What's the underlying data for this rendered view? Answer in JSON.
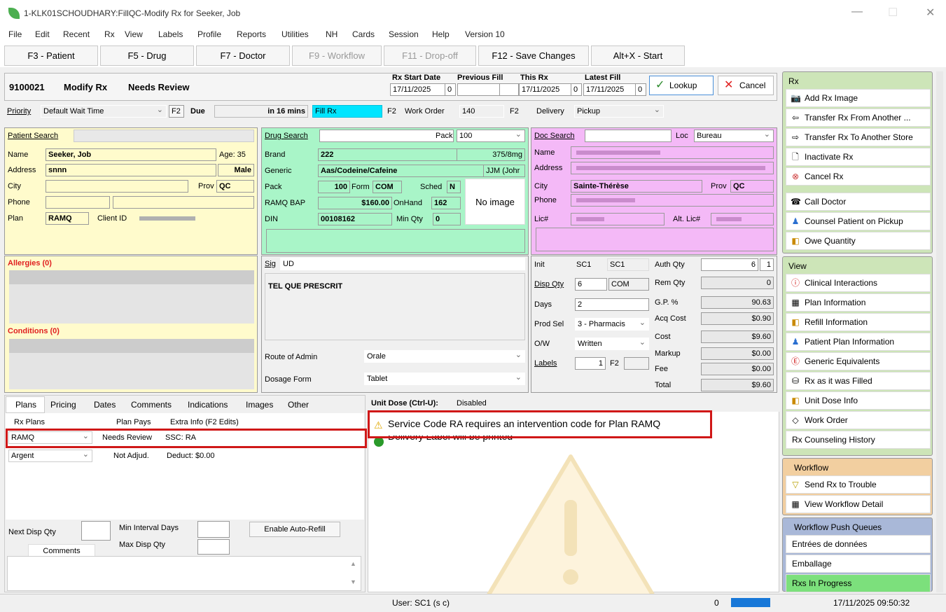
{
  "window": {
    "title": "1-KLK01SCHOUDHARY:FillQC-Modify Rx for Seeker, Job"
  },
  "menu": [
    "File",
    "Edit",
    "Recent",
    "Rx",
    "View",
    "Labels",
    "Profile",
    "Reports",
    "Utilities",
    "NH",
    "Cards",
    "Session",
    "Help",
    "Version 10"
  ],
  "fkeys": [
    "F3 - Patient",
    "F5 - Drug",
    "F7 - Doctor",
    "F9 - Workflow",
    "F11 - Drop-off",
    "F12 - Save Changes",
    "Alt+X - Start"
  ],
  "header": {
    "rx_number": "9100021",
    "mode": "Modify Rx",
    "status": "Needs Review",
    "start_date_label": "Rx Start Date",
    "start_date": "17/11/2025",
    "start_n": "0",
    "prev_fill_label": "Previous Fill",
    "this_rx_label": "This Rx",
    "this_rx": "17/11/2025",
    "this_rx_n": "0",
    "latest_fill_label": "Latest Fill",
    "latest_fill": "17/11/2025",
    "latest_n": "0",
    "lookup": "Lookup",
    "cancel": "Cancel"
  },
  "row2": {
    "priority_label": "Priority",
    "priority": "Default Wait Time",
    "f2": "F2",
    "due_label": "Due",
    "due": "in 16 mins",
    "fill": "Fill Rx",
    "work_order_label": "Work Order",
    "work_order": "140",
    "delivery_label": "Delivery",
    "delivery": "Pickup"
  },
  "patient": {
    "search_label": "Patient Search",
    "name_label": "Name",
    "name": "Seeker, Job",
    "age": "Age: 35",
    "address_label": "Address",
    "address": "snnn",
    "sex": "Male",
    "city_label": "City",
    "prov_label": "Prov",
    "prov": "QC",
    "phone_label": "Phone",
    "plan_label": "Plan",
    "plan": "RAMQ",
    "client_label": "Client ID",
    "allergies": "Allergies (0)",
    "conditions": "Conditions (0)"
  },
  "drug": {
    "search_label": "Drug Search",
    "pack_label": "Pack",
    "pack": "100",
    "brand_label": "Brand",
    "brand": "222",
    "strength": "375/8mg",
    "generic_label": "Generic",
    "generic": "Aas/Codeine/Cafeine",
    "mfr": "JJM (Johr",
    "pack2_label": "Pack",
    "pack2": "100",
    "form_label": "Form",
    "form": "COM",
    "sched_label": "Sched",
    "sched": "N",
    "bap_label": "RAMQ BAP",
    "bap": "$160.00",
    "onhand_label": "OnHand",
    "onhand": "162",
    "din_label": "DIN",
    "din": "00108162",
    "minqty_label": "Min Qty",
    "minqty": "0",
    "noimage": "No image"
  },
  "doc": {
    "search_label": "Doc Search",
    "loc_label": "Loc",
    "loc": "Bureau",
    "name_label": "Name",
    "address_label": "Address",
    "city_label": "City",
    "city": "Sainte-Thérèse",
    "prov_label": "Prov",
    "prov": "QC",
    "phone_label": "Phone",
    "lic_label": "Lic#",
    "altlic_label": "Alt. Lic#"
  },
  "sig": {
    "label": "Sig",
    "code": "UD",
    "text": "TEL QUE PRESCRIT",
    "route_label": "Route of Admin",
    "route": "Orale",
    "dosage_label": "Dosage Form",
    "dosage": "Tablet"
  },
  "qty": {
    "init_label": "Init",
    "init1": "SC1",
    "init2": "SC1",
    "disp_label": "Disp Qty",
    "disp": "6",
    "disp_unit": "COM",
    "days_label": "Days",
    "days": "2",
    "prodsel_label": "Prod Sel",
    "prodsel": "3 - Pharmacis",
    "ow_label": "O/W",
    "ow": "Written",
    "labels_label": "Labels",
    "labels": "1",
    "f2": "F2"
  },
  "pricing": {
    "auth_label": "Auth Qty",
    "auth": "6",
    "auth2": "1",
    "rem_label": "Rem Qty",
    "rem": "0",
    "gp_label": "G.P. %",
    "gp": "90.63",
    "acq_label": "Acq Cost",
    "acq": "$0.90",
    "cost_label": "Cost",
    "cost": "$9.60",
    "markup_label": "Markup",
    "markup": "$0.00",
    "fee_label": "Fee",
    "fee": "$0.00",
    "total_label": "Total",
    "total": "$9.60"
  },
  "tabs": [
    "Plans",
    "Pricing",
    "Dates",
    "Comments",
    "Indications",
    "Images",
    "Other"
  ],
  "plans": {
    "col1": "Rx Plans",
    "col2": "Plan Pays",
    "col3": "Extra Info (F2 Edits)",
    "row1_plan": "RAMQ",
    "row1_pays": "Needs Review",
    "row1_info": "SSC: RA",
    "row2_plan": "Argent",
    "row2_pays": "Not Adjud.",
    "row2_info": "Deduct: $0.00",
    "next_label": "Next Disp Qty",
    "minint_label": "Min Interval Days",
    "maxdisp_label": "Max Disp Qty",
    "autorefill": "Enable Auto-Refill",
    "comments": "Comments"
  },
  "messages": {
    "unit_dose": "Unit Dose (Ctrl-U):",
    "unit_dose_val": "Disabled",
    "msg1": "Service Code RA requires an intervention code for Plan RAMQ",
    "msg2": "Delivery Label will be printed"
  },
  "sidebar": {
    "rx_head": "Rx",
    "rx_items": [
      "Add Rx Image",
      "Transfer Rx From Another ...",
      "Transfer Rx To Another Store",
      "Inactivate Rx",
      "Cancel Rx",
      "Call Doctor",
      "Counsel Patient on Pickup",
      "Owe Quantity"
    ],
    "view_head": "View",
    "view_items": [
      "Clinical Interactions",
      "Plan Information",
      "Refill Information",
      "Patient Plan Information",
      "Generic Equivalents",
      "Rx as it was Filled",
      "Unit Dose Info",
      "Work Order",
      "Rx Counseling History"
    ],
    "wf_head": "Workflow",
    "wf_items": [
      "Send Rx to Trouble",
      "View Workflow Detail"
    ],
    "q_head": "Workflow Push Queues",
    "q_items": [
      "Entrées de données",
      "Emballage",
      "Rxs In Progress"
    ]
  },
  "status": {
    "user": "User: SC1 (s c)",
    "count": "0",
    "datetime": "17/11/2025 09:50:32"
  }
}
